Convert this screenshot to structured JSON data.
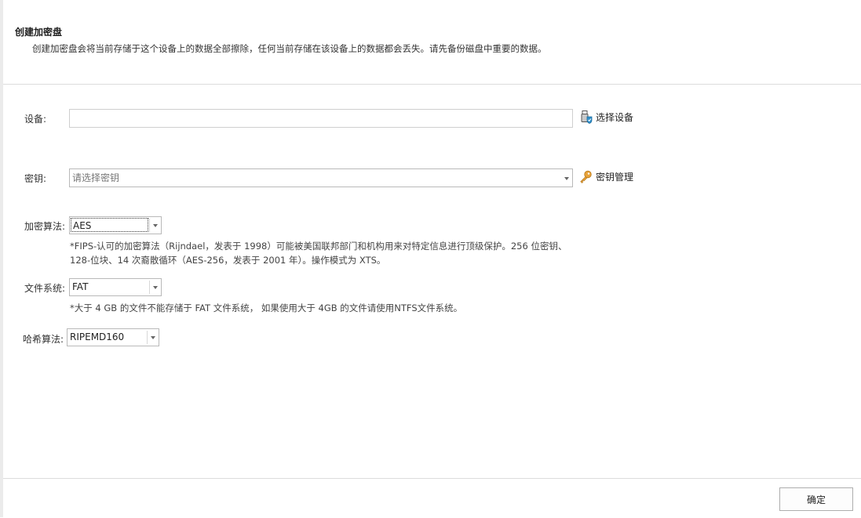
{
  "header": {
    "title": "创建加密盘",
    "description": "创建加密盘会将当前存储于这个设备上的数据全部擦除，任何当前存储在该设备上的数据都会丢失。请先备份磁盘中重要的数据。"
  },
  "device": {
    "label": "设备:",
    "value": "",
    "select_button": "选择设备",
    "icon": "usb-shield-icon"
  },
  "key": {
    "label": "密钥:",
    "placeholder": "请选择密钥",
    "manage_button": "密钥管理",
    "icon": "key-icon"
  },
  "algorithm": {
    "label": "加密算法:",
    "value": "AES",
    "note_line1": "*FIPS-认可的加密算法（Rijndael，发表于 1998）可能被美国联邦部门和机构用来对特定信息进行顶级保护。256 位密钥、",
    "note_line2": "128-位块、14 次裔散循环（AES-256，发表于 2001 年）。操作模式为 XTS。"
  },
  "filesystem": {
    "label": "文件系统:",
    "value": "FAT",
    "note": "*大于 4 GB 的文件不能存储于 FAT 文件系统， 如果使用大于 4GB 的文件请使用NTFS文件系统。"
  },
  "hash": {
    "label": "哈希算法:",
    "value": "RIPEMD160"
  },
  "footer": {
    "ok_label": "确定"
  },
  "colors": {
    "key_icon": "#e8a33a",
    "device_icon_shield": "#2f8fc9",
    "border": "#cfcfcf"
  }
}
